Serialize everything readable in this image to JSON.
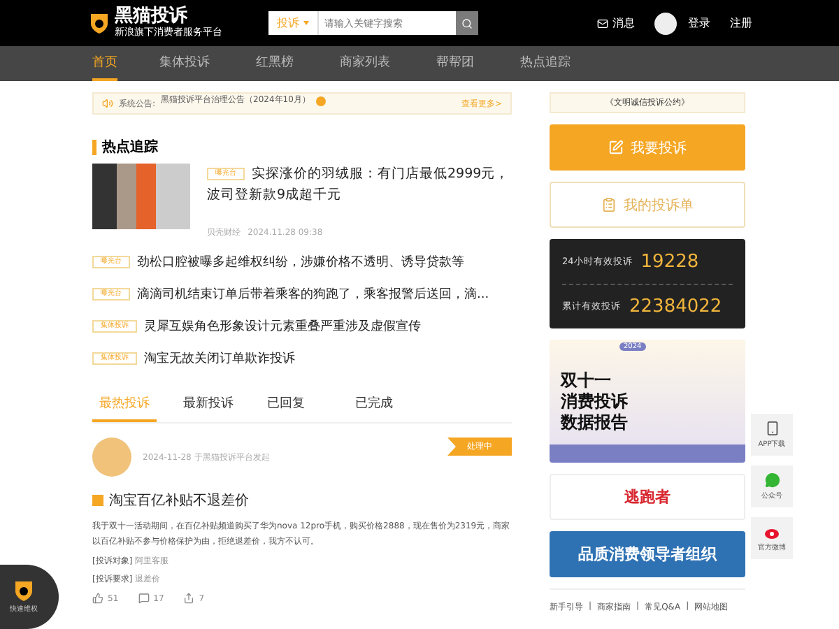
{
  "header": {
    "logo_title": "黑猫投诉",
    "logo_slogan": "新浪旗下消费者服务平台",
    "search": {
      "scope": "投诉",
      "placeholder": "请输入关键字搜索"
    },
    "links": [
      {
        "kind": "message",
        "label": "消息"
      },
      {
        "kind": "avatar"
      },
      {
        "kind": "link",
        "label": "登录"
      },
      {
        "kind": "link",
        "label": "注册"
      }
    ]
  },
  "nav": [
    {
      "label": "首页",
      "selected": true
    },
    {
      "label": "集体投诉",
      "selected": false
    },
    {
      "label": "红黑榜",
      "selected": false
    },
    {
      "label": "商家列表",
      "selected": false
    },
    {
      "label": "帮帮团",
      "selected": false
    },
    {
      "label": "热点追踪",
      "selected": false
    }
  ],
  "notice": {
    "label": "系统公告:",
    "text": "黑猫投诉平台治理公告（2024年10月）",
    "more": "查看更多>"
  },
  "hot": {
    "title": "热点追踪",
    "featured": {
      "tag": "曝光台",
      "title": "实探涨价的羽绒服：有门店最低2999元，波司登新款9成超千元",
      "source": "贝壳财经",
      "time": "2024.11.28 09:38"
    },
    "items": [
      {
        "tag": "曝光台",
        "title": "劲松口腔被曝多起维权纠纷，涉嫌价格不透明、诱导贷款等"
      },
      {
        "tag": "曝光台",
        "title": "滴滴司机结束订单后带着乘客的狗跑了，乘客报警后送回，滴..."
      },
      {
        "tag": "集体投诉",
        "title": "灵犀互娱角色形象设计元素重叠严重涉及虚假宣传"
      },
      {
        "tag": "集体投诉",
        "title": "淘宝无故关闭订单欺诈投诉"
      }
    ]
  },
  "tabs": [
    {
      "label": "最热投诉",
      "selected": true
    },
    {
      "label": "最新投诉",
      "selected": false
    },
    {
      "label": "已回复",
      "selected": false
    },
    {
      "label": "已完成",
      "selected": false
    }
  ],
  "complaint": {
    "meta": "2024-11-28 于黑猫投诉平台发起",
    "status": "处理中",
    "title": "淘宝百亿补贴不退差价",
    "body": "我于双十一活动期间，在百亿补贴频道购买了华为nova 12pro手机，购买价格2888，现在售价为2319元，商家以百亿补贴不参与价格保护为由，拒绝退差价，我方不认可。",
    "fields": [
      {
        "label": "[投诉对象]",
        "value": "阿里客服"
      },
      {
        "label": "[投诉要求]",
        "value": "退差价"
      }
    ],
    "actions": [
      {
        "kind": "like",
        "count": "51"
      },
      {
        "kind": "comment",
        "count": "17"
      },
      {
        "kind": "share",
        "count": "7"
      }
    ]
  },
  "side": {
    "pact": "《文明诚信投诉公约》",
    "complain_button": "我要投诉",
    "my_button": "我的投诉单",
    "stats": [
      {
        "label": "24小时有效投诉",
        "value": "19228"
      },
      {
        "label": "累计有效投诉",
        "value": "22384022"
      }
    ],
    "banners": [
      {
        "kind": "report",
        "lines": [
          "双十一",
          "消费投诉",
          "数据报告"
        ],
        "badge": "2024"
      },
      {
        "kind": "brand",
        "lines": [
          "逃跑者"
        ]
      },
      {
        "kind": "org",
        "lines": [
          "品质消费领导者组织"
        ]
      }
    ],
    "footer": [
      "新手引导",
      "商家指南",
      "常见Q&A",
      "网站地图"
    ],
    "footer_separator": "|"
  },
  "float": [
    {
      "kind": "phone",
      "label": "APP下载"
    },
    {
      "kind": "wechat",
      "label": "公众号"
    },
    {
      "kind": "weibo",
      "label": "官方微博"
    }
  ],
  "corner": {
    "label": "快速维权"
  }
}
